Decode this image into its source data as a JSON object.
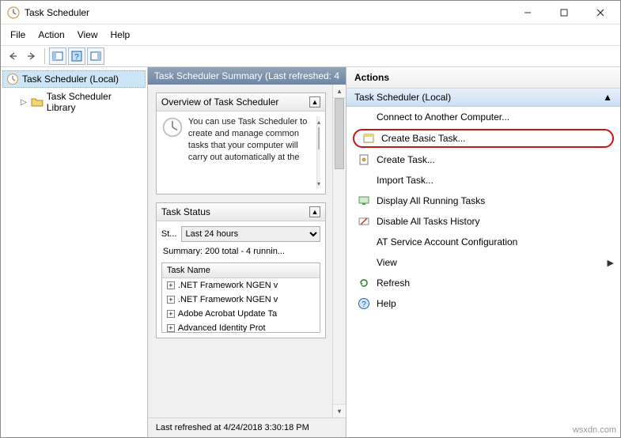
{
  "title": "Task Scheduler",
  "menus": [
    "File",
    "Action",
    "View",
    "Help"
  ],
  "tree": {
    "root": "Task Scheduler (Local)",
    "child": "Task Scheduler Library"
  },
  "center": {
    "header": "Task Scheduler Summary (Last refreshed: 4",
    "overview": {
      "title": "Overview of Task Scheduler",
      "text": "You can use Task Scheduler to create and manage common tasks that your computer will carry out automatically at the"
    },
    "status": {
      "title": "Task Status",
      "status_label": "St...",
      "range_selected": "Last 24 hours",
      "summary": "Summary: 200 total - 4 runnin...",
      "col_header": "Task Name",
      "tasks": [
        ".NET Framework NGEN v",
        ".NET Framework NGEN v",
        "Adobe Acrobat Update Ta",
        "Advanced Identity Prot"
      ]
    },
    "footer": "Last refreshed at 4/24/2018 3:30:18 PM"
  },
  "actions": {
    "title": "Actions",
    "context": "Task Scheduler (Local)",
    "items": [
      {
        "label": "Connect to Another Computer...",
        "icon": "blank"
      },
      {
        "label": "Create Basic Task...",
        "icon": "wizard",
        "highlighted": true
      },
      {
        "label": "Create Task...",
        "icon": "task"
      },
      {
        "label": "Import Task...",
        "icon": "blank"
      },
      {
        "label": "Display All Running Tasks",
        "icon": "display"
      },
      {
        "label": "Disable All Tasks History",
        "icon": "disable"
      },
      {
        "label": "AT Service Account Configuration",
        "icon": "blank"
      },
      {
        "label": "View",
        "icon": "blank",
        "submenu": true
      },
      {
        "label": "Refresh",
        "icon": "refresh"
      },
      {
        "label": "Help",
        "icon": "help"
      }
    ]
  },
  "watermark": "wsxdn.com"
}
